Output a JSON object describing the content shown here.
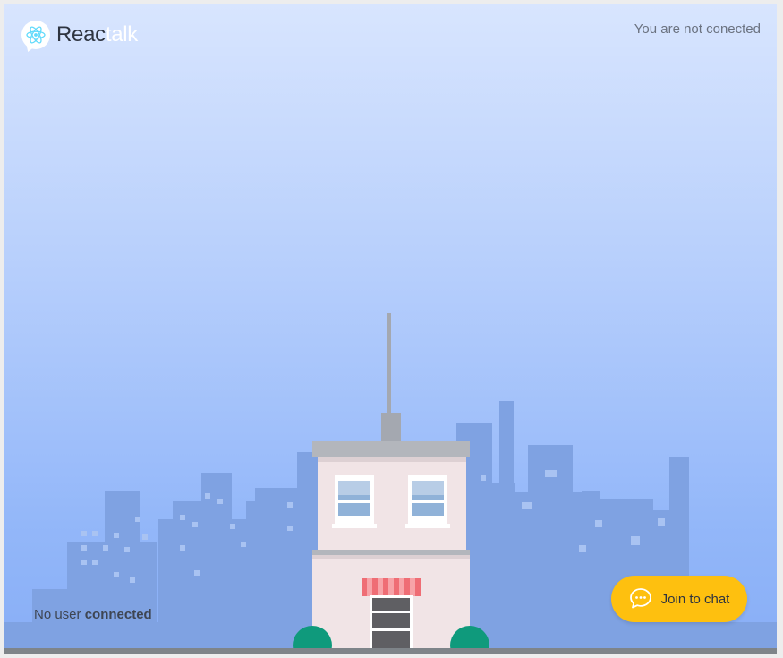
{
  "app": {
    "logo_text_main": "Reac",
    "logo_text_accent": "talk"
  },
  "header": {
    "connection_status": "You are not conected"
  },
  "footer": {
    "users_prefix": "No user",
    "users_suffix": "connected",
    "join_button_label": "Join to chat"
  },
  "icons": {
    "logo": "react-atom-icon",
    "join_button": "chat-bubble-icon"
  },
  "colors": {
    "sky_top": "#d8e5fe",
    "sky_bottom": "#88aef6",
    "skyline": "#7fa2e2",
    "button": "#fec00f",
    "react_logo": "#61dafb",
    "bush": "#0f9a7c"
  }
}
